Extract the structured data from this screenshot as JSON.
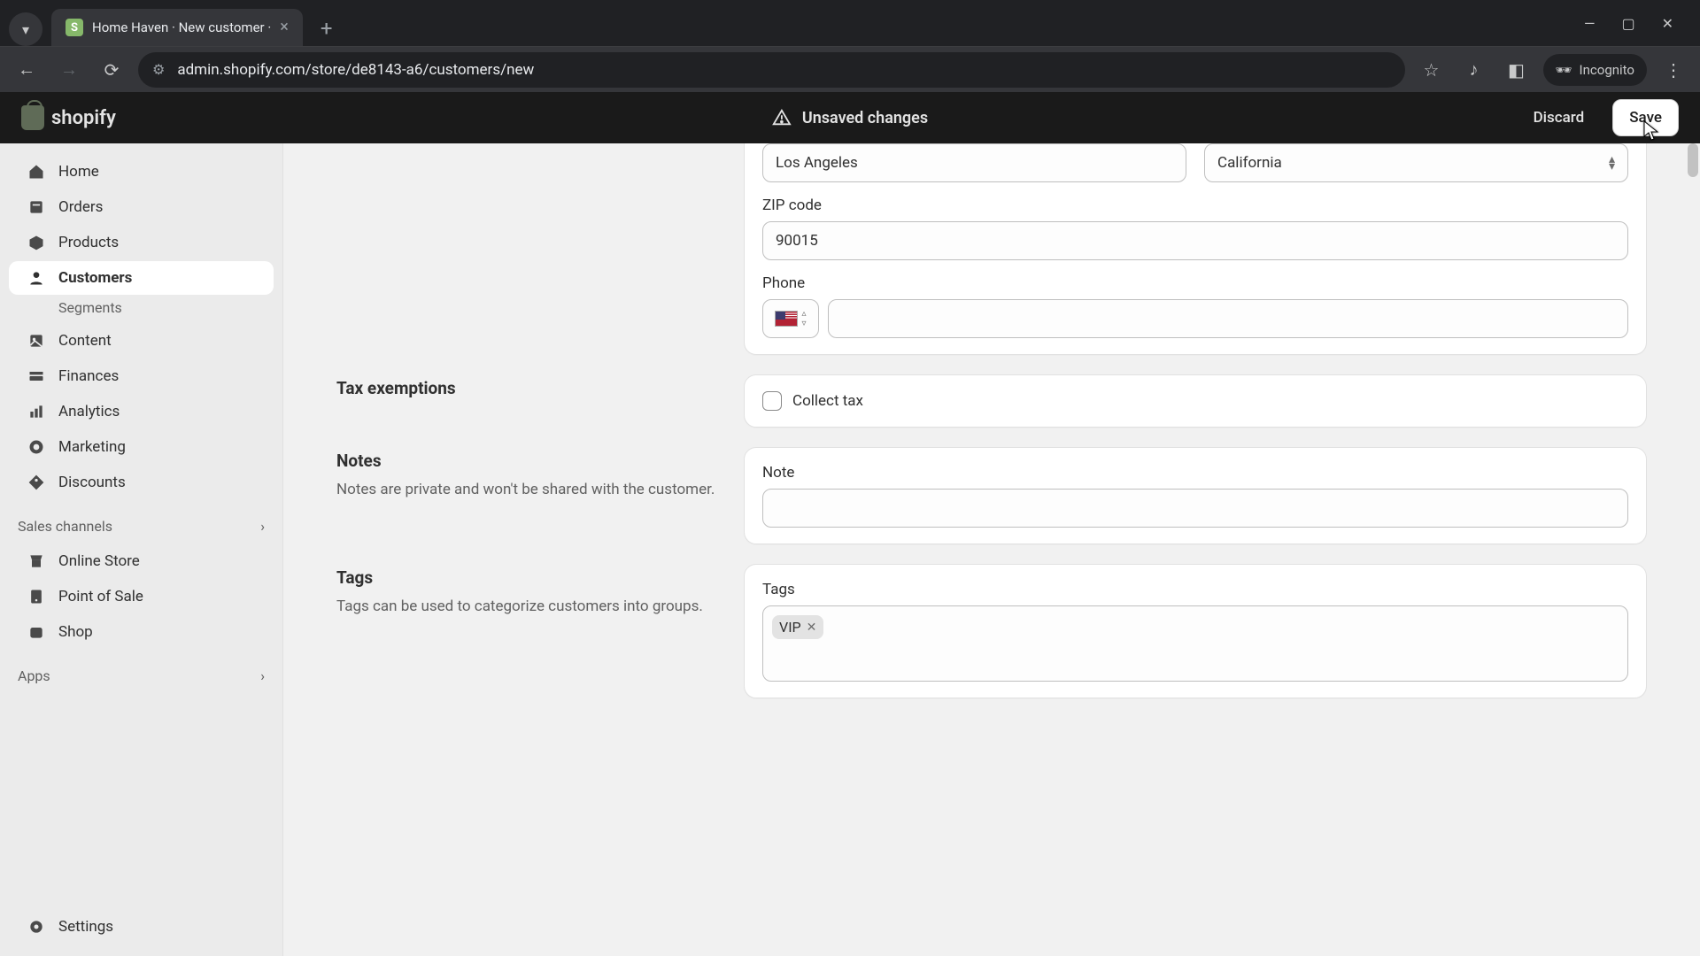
{
  "browser": {
    "tab_title": "Home Haven · New customer ·",
    "url": "admin.shopify.com/store/de8143-a6/customers/new",
    "incognito_label": "Incognito"
  },
  "topbar": {
    "brand": "shopify",
    "status": "Unsaved changes",
    "discard_label": "Discard",
    "save_label": "Save"
  },
  "sidebar": {
    "items": [
      {
        "icon": "home",
        "label": "Home"
      },
      {
        "icon": "orders",
        "label": "Orders"
      },
      {
        "icon": "products",
        "label": "Products"
      },
      {
        "icon": "customers",
        "label": "Customers",
        "active": true
      },
      {
        "icon": "content",
        "label": "Content"
      },
      {
        "icon": "finances",
        "label": "Finances"
      },
      {
        "icon": "analytics",
        "label": "Analytics"
      },
      {
        "icon": "marketing",
        "label": "Marketing"
      },
      {
        "icon": "discounts",
        "label": "Discounts"
      }
    ],
    "customers_sub": "Segments",
    "group_sales": "Sales channels",
    "sales_items": [
      "Online Store",
      "Point of Sale",
      "Shop"
    ],
    "group_apps": "Apps",
    "settings": "Settings"
  },
  "form": {
    "city_value": "Los Angeles",
    "state_value": "California",
    "zip_label": "ZIP code",
    "zip_value": "90015",
    "phone_label": "Phone",
    "phone_value": "",
    "tax_section_title": "Tax exemptions",
    "collect_tax_label": "Collect tax",
    "notes_title": "Notes",
    "notes_desc": "Notes are private and won't be shared with the customer.",
    "note_label": "Note",
    "note_value": "",
    "tags_title": "Tags",
    "tags_desc": "Tags can be used to categorize customers into groups.",
    "tags_label": "Tags",
    "tags": [
      "VIP"
    ]
  }
}
